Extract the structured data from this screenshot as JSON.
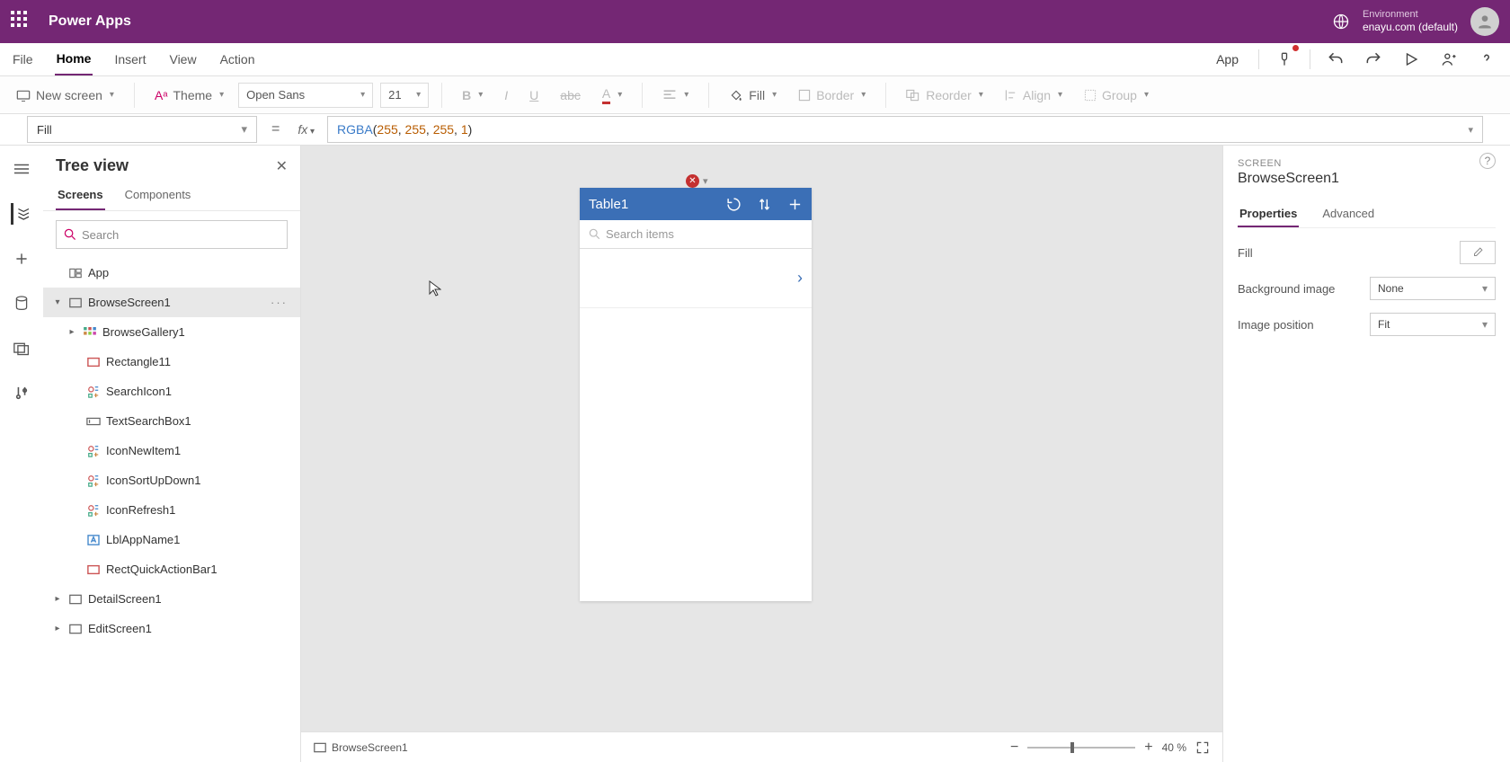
{
  "titlebar": {
    "app_name": "Power Apps",
    "env_label": "Environment",
    "env_value": "enayu.com (default)"
  },
  "menubar": {
    "items": [
      "File",
      "Home",
      "Insert",
      "View",
      "Action"
    ],
    "active": "Home",
    "app_label": "App"
  },
  "toolbar": {
    "new_screen": "New screen",
    "theme": "Theme",
    "font_name": "Open Sans",
    "font_size": "21",
    "fill": "Fill",
    "border": "Border",
    "reorder": "Reorder",
    "align": "Align",
    "group": "Group"
  },
  "formula": {
    "property": "Fill",
    "fn": "RGBA",
    "args": [
      "255",
      "255",
      "255",
      "1"
    ]
  },
  "tree": {
    "title": "Tree view",
    "tabs": {
      "screens": "Screens",
      "components": "Components"
    },
    "search_placeholder": "Search",
    "app": "App",
    "items": [
      {
        "name": "BrowseScreen1",
        "selected": true,
        "expanded": true,
        "icon": "screen",
        "children": [
          {
            "name": "BrowseGallery1",
            "icon": "gallery",
            "toggle": ">"
          },
          {
            "name": "Rectangle11",
            "icon": "rect"
          },
          {
            "name": "SearchIcon1",
            "icon": "iconctl"
          },
          {
            "name": "TextSearchBox1",
            "icon": "textinput"
          },
          {
            "name": "IconNewItem1",
            "icon": "iconctl"
          },
          {
            "name": "IconSortUpDown1",
            "icon": "iconctl"
          },
          {
            "name": "IconRefresh1",
            "icon": "iconctl"
          },
          {
            "name": "LblAppName1",
            "icon": "label"
          },
          {
            "name": "RectQuickActionBar1",
            "icon": "rect"
          }
        ]
      },
      {
        "name": "DetailScreen1",
        "icon": "screen",
        "toggle": ">"
      },
      {
        "name": "EditScreen1",
        "icon": "screen",
        "toggle": ">"
      }
    ]
  },
  "phone": {
    "header_title": "Table1",
    "search_placeholder": "Search items"
  },
  "properties": {
    "section_label": "SCREEN",
    "section_name": "BrowseScreen1",
    "tabs": {
      "properties": "Properties",
      "advanced": "Advanced"
    },
    "fill_label": "Fill",
    "bg_label": "Background image",
    "bg_value": "None",
    "pos_label": "Image position",
    "pos_value": "Fit"
  },
  "status": {
    "screen": "BrowseScreen1",
    "zoom": "40",
    "zoom_unit": "%"
  }
}
